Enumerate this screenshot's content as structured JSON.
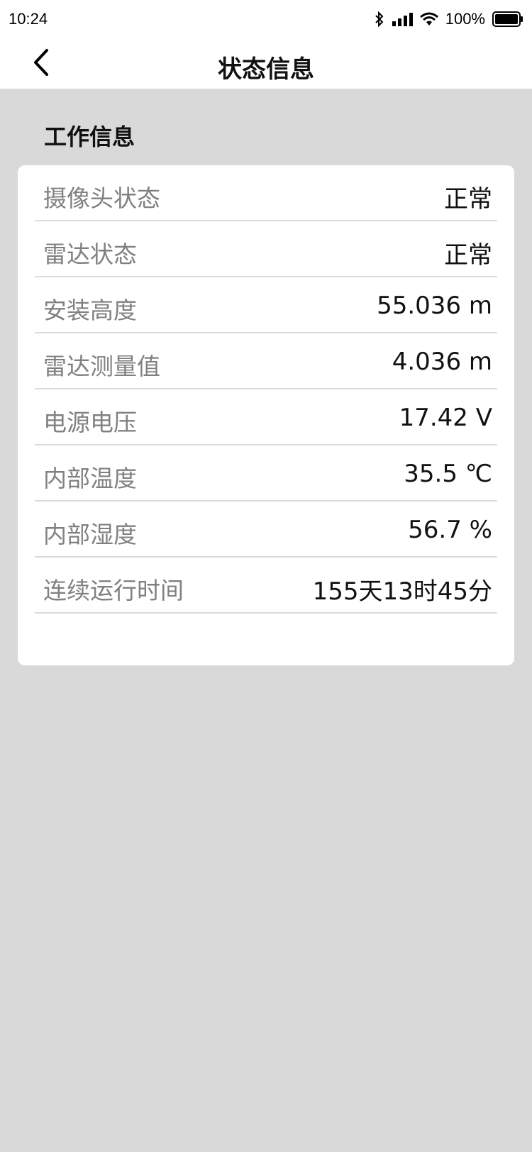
{
  "status_bar": {
    "time": "10:24",
    "battery": "100%",
    "icons": [
      "bluetooth-icon",
      "signal-icon",
      "wifi-icon",
      "battery-icon"
    ]
  },
  "header": {
    "title": "状态信息",
    "back_icon": "chevron-left-icon"
  },
  "section": {
    "title": "工作信息"
  },
  "rows": [
    {
      "label": "摄像头状态",
      "value": "正常"
    },
    {
      "label": "雷达状态",
      "value": "正常"
    },
    {
      "label": "安装高度",
      "value": "55.036 m"
    },
    {
      "label": "雷达测量值",
      "value": "4.036 m"
    },
    {
      "label": "电源电压",
      "value": "17.42 V"
    },
    {
      "label": "内部温度",
      "value": "35.5 ℃"
    },
    {
      "label": "内部湿度",
      "value": "56.7 %"
    },
    {
      "label": "连续运行时间",
      "value": "155天13时45分"
    }
  ],
  "colors": {
    "background": "#d9d9d9",
    "card": "#ffffff",
    "label": "#808080",
    "value": "#111111",
    "divider": "#dcdcdc"
  }
}
